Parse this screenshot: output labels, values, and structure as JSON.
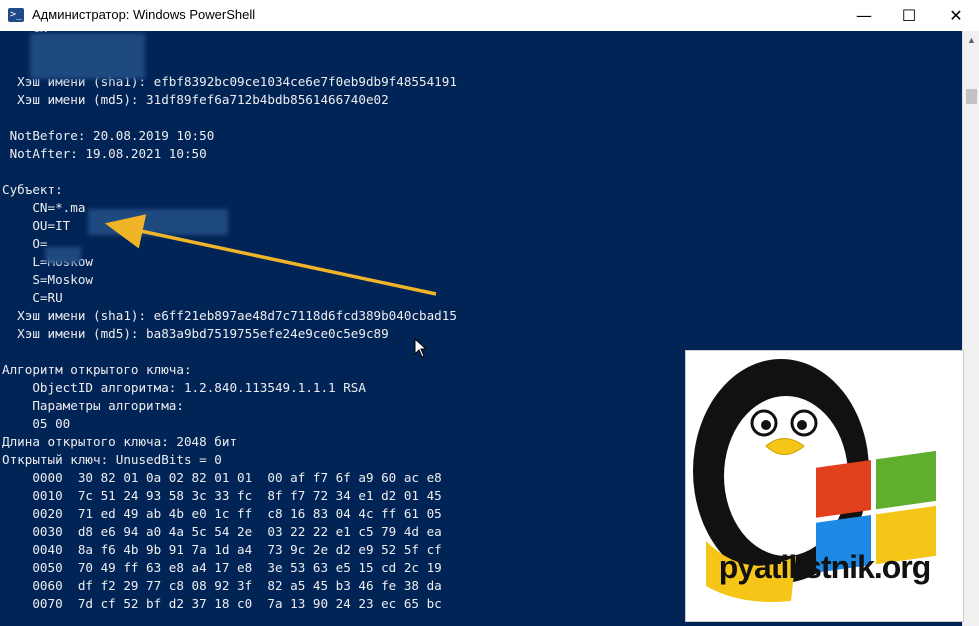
{
  "window": {
    "title": "Администратор: Windows PowerShell",
    "icon": "powershell-icon",
    "controls": {
      "minimize": "—",
      "maximize": "☐",
      "close": "✕"
    }
  },
  "console": {
    "lines": [
      "    CN=",
      "",
      "",
      "  Хэш имени (sha1): efbf8392bc09ce1034ce6e7f0eb9db9f48554191",
      "  Хэш имени (md5): 31df89fef6a712b4bdb8561466740e02",
      "",
      " NotBefore: 20.08.2019 10:50",
      " NotAfter: 19.08.2021 10:50",
      "",
      "Субъект:",
      "    CN=*.ma",
      "    OU=IT",
      "    O=",
      "    L=Moskow",
      "    S=Moskow",
      "    C=RU",
      "  Хэш имени (sha1): e6ff21eb897ae48d7c7118d6fcd389b040cbad15",
      "  Хэш имени (md5): ba83a9bd7519755efe24e9ce0c5e9c89",
      "",
      "Алгоритм открытого ключа:",
      "    ObjectID алгоритма: 1.2.840.113549.1.1.1 RSA",
      "    Параметры алгоритма:",
      "    05 00",
      "Длина открытого ключа: 2048 бит",
      "Открытый ключ: UnusedBits = 0",
      "    0000  30 82 01 0a 02 82 01 01  00 af f7 6f a9 60 ac e8",
      "    0010  7c 51 24 93 58 3c 33 fc  8f f7 72 34 e1 d2 01 45",
      "    0020  71 ed 49 ab 4b e0 1c ff  c8 16 83 04 4c ff 61 05",
      "    0030  d8 e6 94 a0 4a 5c 54 2e  03 22 22 e1 c5 79 4d ea",
      "    0040  8a f6 4b 9b 91 7a 1d a4  73 9c 2e d2 e9 52 5f cf",
      "    0050  70 49 ff 63 e8 a4 17 e8  3e 53 63 e5 15 cd 2c 19",
      "    0060  df f2 29 77 c8 08 92 3f  82 a5 45 b3 46 fe 38 da",
      "    0070  7d cf 52 bf d2 37 18 c0  7a 13 90 24 23 ec 65 bc"
    ]
  },
  "overlay": {
    "logo_text": "pyatilistnik.org",
    "arrow_color": "#f0b429"
  },
  "colors": {
    "console_bg": "#012456",
    "console_fg": "#eeedf0"
  }
}
